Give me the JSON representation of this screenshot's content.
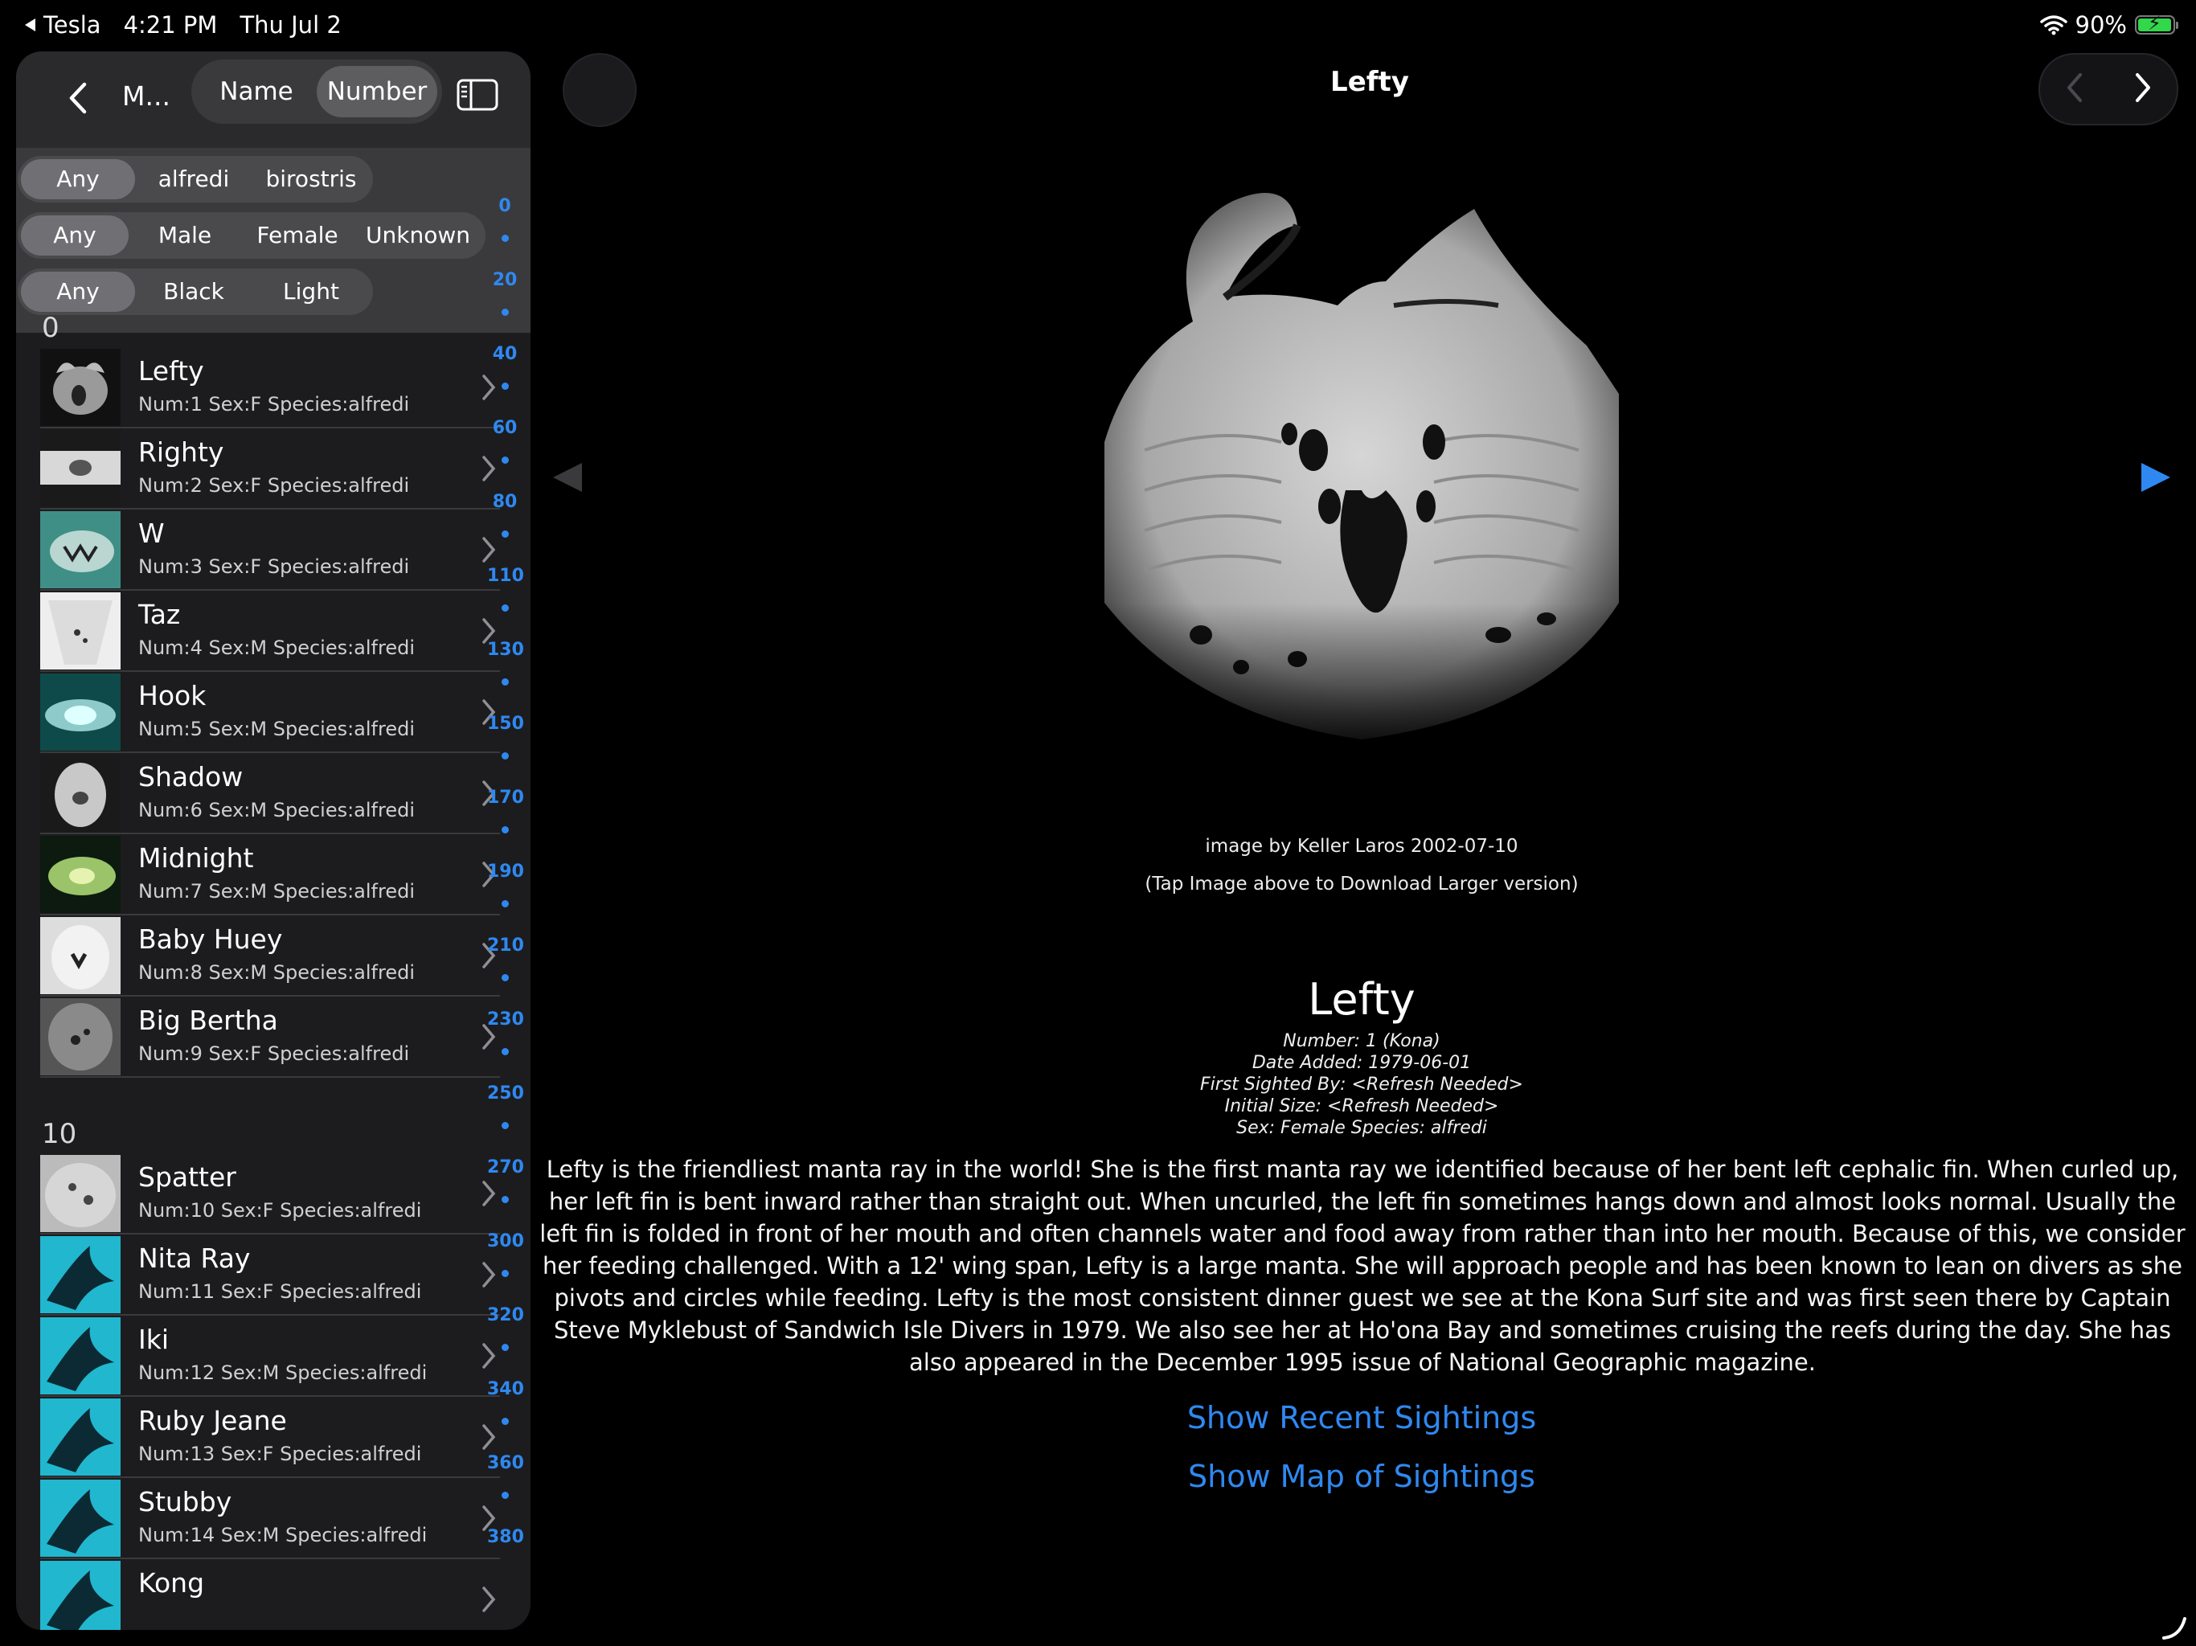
{
  "status_bar": {
    "back_app": "Tesla",
    "time": "4:21 PM",
    "date": "Thu Jul 2",
    "battery": "90%"
  },
  "sidebar": {
    "title": "M...",
    "sort_options": [
      "Name",
      "Number"
    ],
    "selected_sort": "Number",
    "filters": {
      "species": [
        "Any",
        "alfredi",
        "birostris"
      ],
      "sex": [
        "Any",
        "Male",
        "Female",
        "Unknown"
      ],
      "color": [
        "Any",
        "Black",
        "Light"
      ]
    },
    "index_labels": [
      "0",
      "20",
      "40",
      "60",
      "80",
      "110",
      "130",
      "150",
      "170",
      "190",
      "210",
      "230",
      "250",
      "270",
      "300",
      "320",
      "340",
      "360",
      "380"
    ],
    "sections": [
      {
        "header": "0",
        "rows": [
          {
            "name": "Lefty",
            "meta": "Num:1   Sex:F   Species:alfredi"
          },
          {
            "name": "Righty",
            "meta": "Num:2   Sex:F   Species:alfredi"
          },
          {
            "name": "W",
            "meta": "Num:3   Sex:F   Species:alfredi"
          },
          {
            "name": "Taz",
            "meta": "Num:4   Sex:M   Species:alfredi"
          },
          {
            "name": "Hook",
            "meta": "Num:5   Sex:M   Species:alfredi"
          },
          {
            "name": "Shadow",
            "meta": "Num:6   Sex:M   Species:alfredi"
          },
          {
            "name": "Midnight",
            "meta": "Num:7   Sex:M   Species:alfredi"
          },
          {
            "name": "Baby Huey",
            "meta": "Num:8   Sex:M   Species:alfredi"
          },
          {
            "name": "Big Bertha",
            "meta": "Num:9   Sex:F   Species:alfredi"
          }
        ]
      },
      {
        "header": "10",
        "rows": [
          {
            "name": "Spatter",
            "meta": "Num:10   Sex:F   Species:alfredi"
          },
          {
            "name": "Nita Ray",
            "meta": "Num:11   Sex:F   Species:alfredi"
          },
          {
            "name": "Iki",
            "meta": "Num:12   Sex:M   Species:alfredi"
          },
          {
            "name": "Ruby Jeane",
            "meta": "Num:13   Sex:F   Species:alfredi"
          },
          {
            "name": "Stubby",
            "meta": "Num:14   Sex:M   Species:alfredi"
          },
          {
            "name": "Kong",
            "meta": ""
          }
        ]
      }
    ]
  },
  "detail": {
    "title": "Lefty",
    "image_credit": "image by Keller Laros 2002-07-10",
    "image_hint": "(Tap Image above to Download Larger version)",
    "name": "Lefty",
    "facts": [
      "Number: 1    (Kona)",
      "Date Added: 1979-06-01",
      "First Sighted By: <Refresh Needed>",
      "Initial Size: <Refresh Needed>",
      "Sex: Female    Species: alfredi"
    ],
    "description": "Lefty is the friendliest manta ray in the world! She is the first manta ray we identified because of her bent left cephalic fin. When curled up, her left fin is bent inward rather than straight out. When uncurled, the left fin sometimes hangs down and almost looks normal. Usually the left fin is folded in front of her mouth and often channels water and food away from rather than into her mouth. Because of this, we consider her feeding challenged. With a 12' wing span, Lefty is a large manta. She will approach people and has been known to lean on divers as she pivots and circles while feeding. Lefty is the most consistent dinner guest we see at the Kona Surf site and was first seen there by Captain Steve Myklebust of Sandwich Isle Divers in 1979. We also see her at Ho'ona Bay and sometimes cruising the reefs during the day. She has also appeared in the December 1995 issue of National Geographic magazine.",
    "links": [
      "Show Recent Sightings",
      "Show Map of Sightings"
    ]
  },
  "colors": {
    "accent": "#2f88f0",
    "background": "#000000",
    "sidebar_bg": "#1c1c1e"
  }
}
